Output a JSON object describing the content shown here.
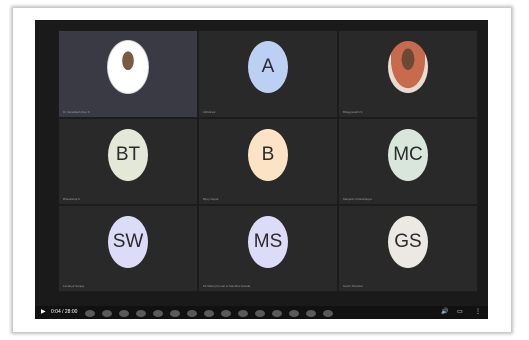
{
  "player": {
    "time": "0:04 / 28:00",
    "play_icon": "play-icon",
    "volume_icon": "volume-icon",
    "captions_icon": "captions-icon",
    "menu_icon": "more-vert-icon"
  },
  "tiles": [
    {
      "initials": "",
      "name": "Dr Varadaiah Rao S",
      "photo": true
    },
    {
      "initials": "A",
      "name": "Abhishek",
      "color": "#bcd0f4"
    },
    {
      "initials": "",
      "name": "Bhagyavathi S",
      "photo": true
    },
    {
      "initials": "BT",
      "name": "Bhaskarraj K",
      "color": "#e4e8d8"
    },
    {
      "initials": "B",
      "name": "Bijoy Gopal",
      "color": "#fce3c6"
    },
    {
      "initials": "MC",
      "name": "Manjesh Chandrappa",
      "color": "#d8e6dc"
    },
    {
      "initials": "SW",
      "name": "Lavanya Sanjay",
      "color": "#dcdcf8"
    },
    {
      "initials": "MS",
      "name": "Mr Manoj Kumar & Samitha Gowda",
      "color": "#dcdcf8"
    },
    {
      "initials": "GS",
      "name": "Gowri Shankar",
      "color": "#ece8e4"
    }
  ]
}
